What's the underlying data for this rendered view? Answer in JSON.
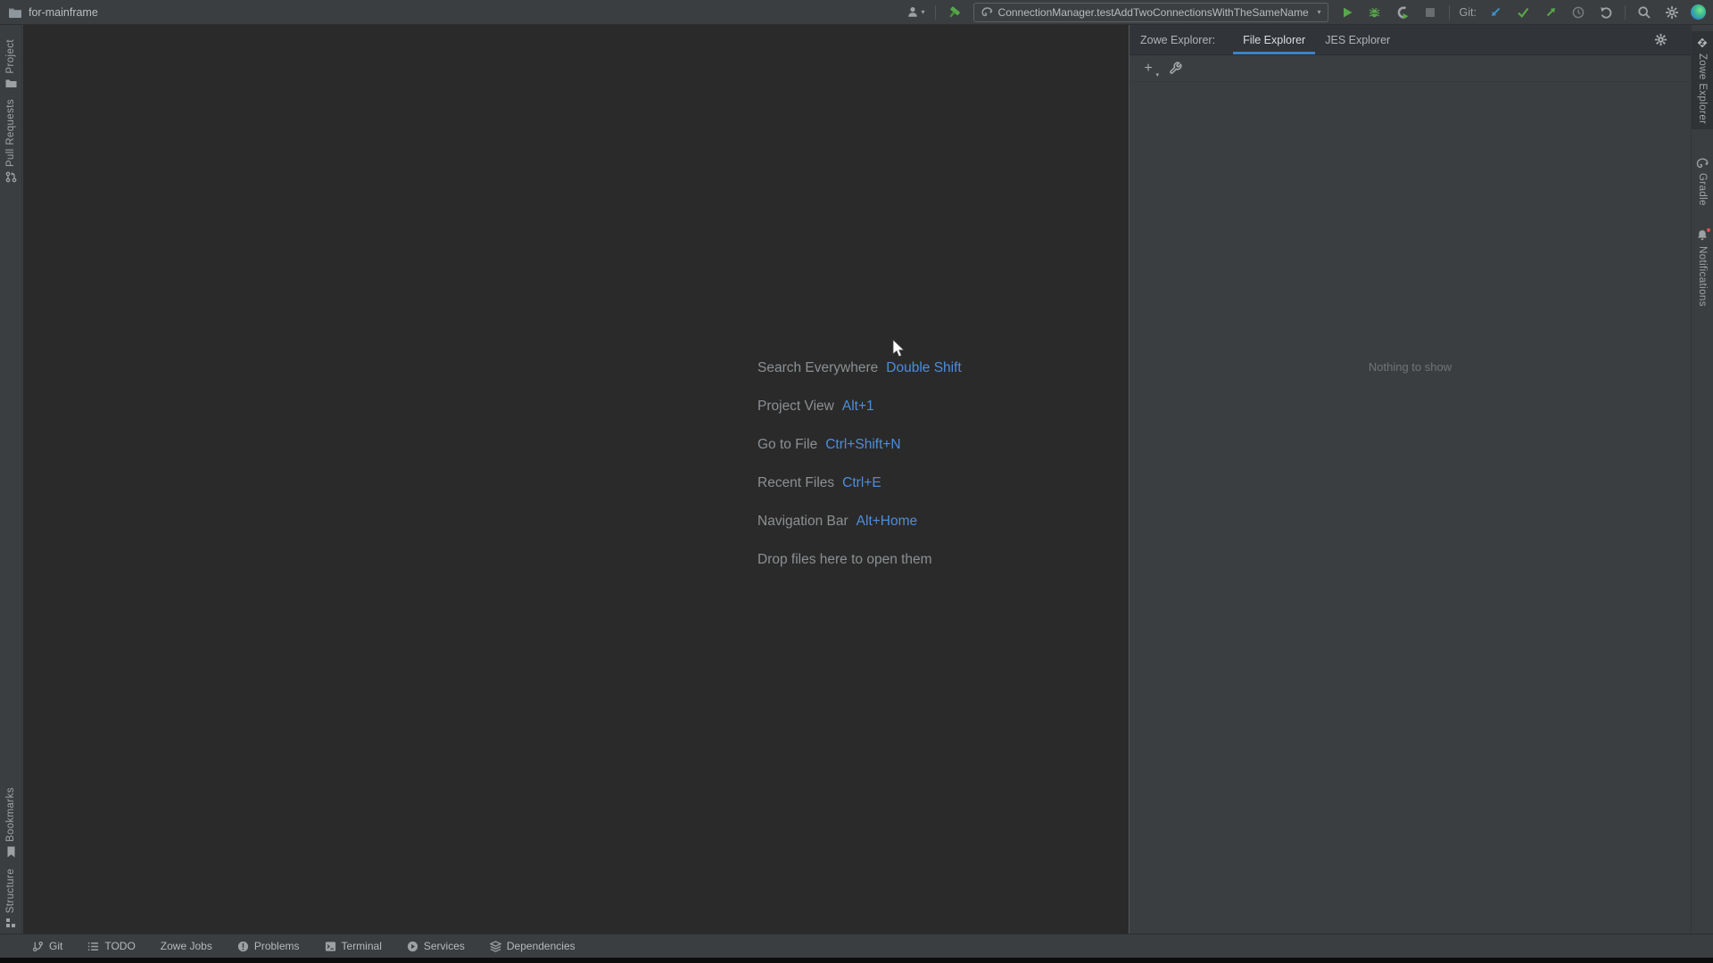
{
  "window": {
    "title": "for-mainframe"
  },
  "toolbar": {
    "run_config": "ConnectionManager.testAddTwoConnectionsWithTheSameName",
    "git_label": "Git:"
  },
  "icons": {
    "add_glyph": "+",
    "caret_glyph": "▾"
  },
  "left_stripe": {
    "top": [
      {
        "label": "Project"
      },
      {
        "label": "Pull Requests"
      }
    ],
    "bottom": [
      {
        "label": "Bookmarks"
      },
      {
        "label": "Structure"
      }
    ]
  },
  "right_stripe": {
    "items": [
      {
        "label": "Zowe Explorer"
      },
      {
        "label": "Gradle"
      },
      {
        "label": "Notifications"
      }
    ]
  },
  "editor": {
    "hints": [
      {
        "label": "Search Everywhere",
        "shortcut": "Double Shift"
      },
      {
        "label": "Project View",
        "shortcut": "Alt+1"
      },
      {
        "label": "Go to File",
        "shortcut": "Ctrl+Shift+N"
      },
      {
        "label": "Recent Files",
        "shortcut": "Ctrl+E"
      },
      {
        "label": "Navigation Bar",
        "shortcut": "Alt+Home"
      }
    ],
    "drop_hint": "Drop files here to open them"
  },
  "right_panel": {
    "title": "Zowe Explorer:",
    "tabs": [
      {
        "label": "File Explorer",
        "active": true
      },
      {
        "label": "JES Explorer",
        "active": false
      }
    ],
    "empty_text": "Nothing to show"
  },
  "statusbar": {
    "items": [
      {
        "label": "Git"
      },
      {
        "label": "TODO"
      },
      {
        "label": "Zowe Jobs"
      },
      {
        "label": "Problems"
      },
      {
        "label": "Terminal"
      },
      {
        "label": "Services"
      },
      {
        "label": "Dependencies"
      }
    ]
  },
  "colors": {
    "chrome_bg": "#3b3e40",
    "editor_bg": "#2a2a2a",
    "header_bg": "#313539",
    "accent_blue": "#4e8ddb",
    "tab_underline": "#3e82c4",
    "green": "#57a64a",
    "update_blue": "#3d8fc9",
    "notification_red": "#e25050",
    "dim_text": "#8c9093"
  }
}
